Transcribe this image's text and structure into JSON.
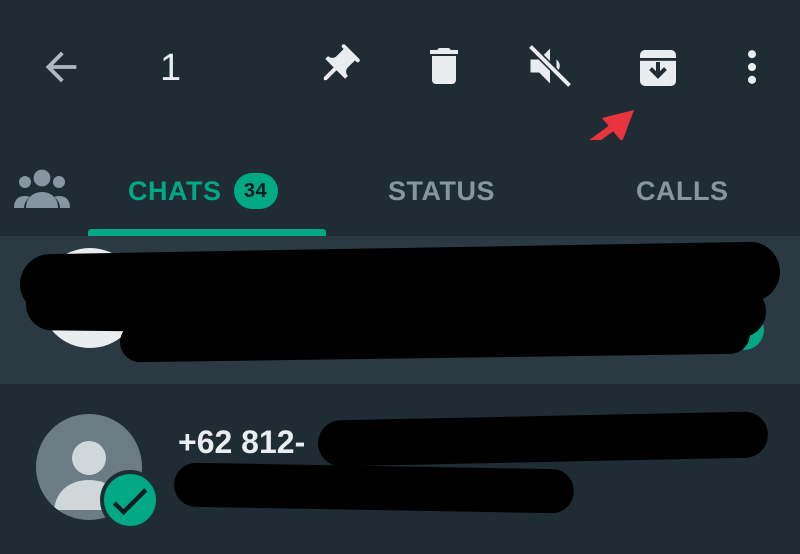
{
  "toolbar": {
    "selected_count": "1",
    "icons": {
      "back": "arrow-left-icon",
      "pin": "pin-icon",
      "delete": "trash-icon",
      "mute": "speaker-muted-icon",
      "archive": "archive-icon",
      "more": "more-vertical-icon"
    }
  },
  "annotation": {
    "arrow_color": "#e8353d",
    "points_to": "archive-icon"
  },
  "tabs": {
    "community_icon": "community-icon",
    "chats": {
      "label": "CHATS",
      "badge": "34"
    },
    "status": {
      "label": "STATUS"
    },
    "calls": {
      "label": "CALLS"
    }
  },
  "chats": [
    {
      "name": "+62 812-",
      "selected": true
    }
  ],
  "colors": {
    "background": "#1f2c34",
    "selected_row": "#2a3942",
    "accent": "#00a884",
    "icon": "#e9edef",
    "muted_text": "#8696a0"
  }
}
